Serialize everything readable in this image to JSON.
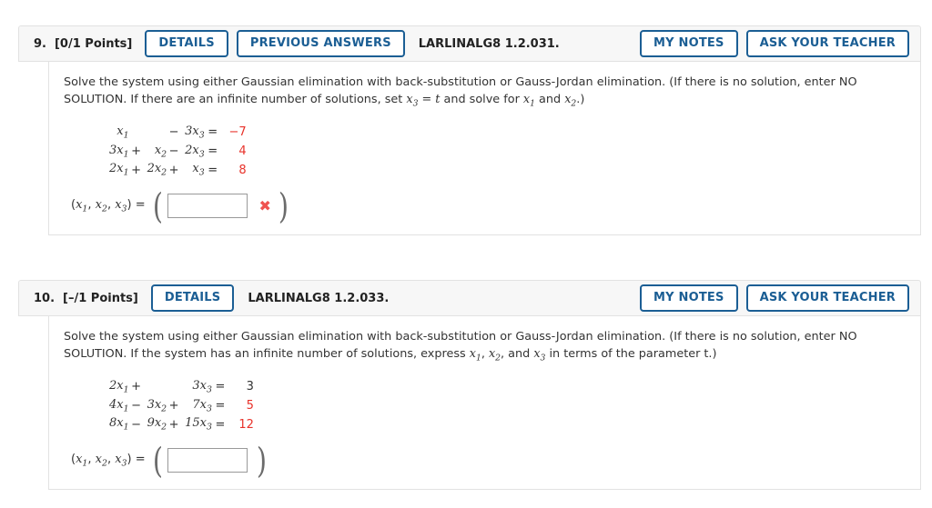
{
  "problems": [
    {
      "number": "9.",
      "points": "[0/1 Points]",
      "code": "LARLINALG8 1.2.031.",
      "buttons_left": [
        "DETAILS",
        "PREVIOUS ANSWERS"
      ],
      "buttons_right": [
        "MY NOTES",
        "ASK YOUR TEACHER"
      ],
      "question": {
        "part1": "Solve the system using either Gaussian elimination with back-substitution or Gauss-Jordan elimination. (If there is no solution, enter NO SOLUTION. If there are an infinite number of solutions, set ",
        "math1": "x",
        "math1_sub": "3",
        "math2": " = t",
        "part2": " and solve for ",
        "math3": "x",
        "math3_sub": "1",
        "part3": " and ",
        "math4": "x",
        "math4_sub": "2",
        "part4": ".)"
      },
      "equations": [
        {
          "t1": "x",
          "t1sub": "1",
          "op1": "",
          "t2": "",
          "t2sub": "",
          "op2": "−",
          "t3": "3x",
          "t3sub": "3",
          "rhs": "−7",
          "rhs_color": "red"
        },
        {
          "t1": "3x",
          "t1sub": "1",
          "op1": "+",
          "t2": "x",
          "t2sub": "2",
          "op2": "−",
          "t3": "2x",
          "t3sub": "3",
          "rhs": "4",
          "rhs_color": "red"
        },
        {
          "t1": "2x",
          "t1sub": "1",
          "op1": "+",
          "t2": "2x",
          "t2sub": "2",
          "op2": "+",
          "t3": "x",
          "t3sub": "3",
          "rhs": "8",
          "rhs_color": "red"
        }
      ],
      "answer": {
        "label_open": "(",
        "label_parts": [
          "x",
          "1",
          ", ",
          "x",
          "2",
          ", ",
          "x",
          "3"
        ],
        "label_close": ") =",
        "input_value": "",
        "input_placeholder": "",
        "mark": "✖",
        "has_mark": true
      }
    },
    {
      "number": "10.",
      "points": "[–/1 Points]",
      "code": "LARLINALG8 1.2.033.",
      "buttons_left": [
        "DETAILS"
      ],
      "buttons_right": [
        "MY NOTES",
        "ASK YOUR TEACHER"
      ],
      "question": {
        "part1": "Solve the system using either Gaussian elimination with back-substitution or Gauss-Jordan elimination. (If there is no solution, enter NO SOLUTION. If the system has an infinite number of solutions, express ",
        "math1": "x",
        "math1_sub": "1",
        "math2": ", ",
        "part2": "x",
        "math3_sub": "2",
        "part3": ", and ",
        "math4": "x",
        "math4_sub": "3",
        "part4": " in terms of the parameter t.)"
      },
      "equations": [
        {
          "t1": "2x",
          "t1sub": "1",
          "op1": "+",
          "t2": "",
          "t2sub": "",
          "op2": "",
          "t3": "3x",
          "t3sub": "3",
          "rhs": "3",
          "rhs_color": "dark"
        },
        {
          "t1": "4x",
          "t1sub": "1",
          "op1": "−",
          "t2": "3x",
          "t2sub": "2",
          "op2": "+",
          "t3": "7x",
          "t3sub": "3",
          "rhs": "5",
          "rhs_color": "red"
        },
        {
          "t1": "8x",
          "t1sub": "1",
          "op1": "−",
          "t2": "9x",
          "t2sub": "2",
          "op2": "+",
          "t3": "15x",
          "t3sub": "3",
          "rhs": "12",
          "rhs_color": "red"
        }
      ],
      "answer": {
        "label_open": "(",
        "label_close": ") =",
        "input_value": "",
        "input_placeholder": "",
        "mark": "",
        "has_mark": false
      }
    }
  ],
  "colors": {
    "accent_blue": "#1b5e94",
    "answer_red": "#e8322a",
    "mark_red": "#ef5350",
    "header_bg": "#f7f7f7",
    "border": "#e2e2e2"
  }
}
